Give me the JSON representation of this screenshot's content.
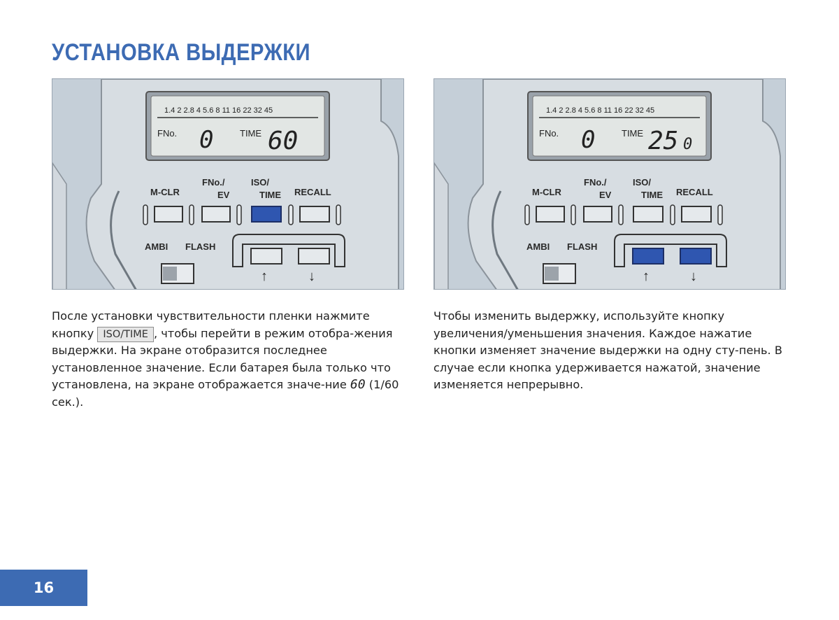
{
  "page": {
    "title": "УСТАНОВКА ВЫДЕРЖКИ",
    "number": "16",
    "accent_color": "#3d6bb3",
    "highlight_button_color": "#2f56b0"
  },
  "figures": [
    {
      "scale": "1.4  2  2.8  4  5.6  8  11  16  22  32  45",
      "fno_label": "FNo.",
      "fno_value": "0",
      "time_label": "TIME",
      "time_value": "60",
      "buttons": {
        "mclr": "M-CLR",
        "fno_ev_top": "FNo./",
        "fno_ev_bottom": "EV",
        "iso_top": "ISO/",
        "iso_bottom": "TIME",
        "recall": "RECALL"
      },
      "switch": {
        "ambi": "AMBI",
        "flash": "FLASH"
      },
      "arrows": {
        "up": "↑",
        "down": "↓"
      },
      "highlighted": [
        "iso-time"
      ]
    },
    {
      "scale": "1.4  2  2.8  4  5.6  8  11  16  22  32  45",
      "fno_label": "FNo.",
      "fno_value": "0",
      "time_label": "TIME",
      "time_value": "25",
      "time_suffix": "0",
      "buttons": {
        "mclr": "M-CLR",
        "fno_ev_top": "FNo./",
        "fno_ev_bottom": "EV",
        "iso_top": "ISO/",
        "iso_bottom": "TIME",
        "recall": "RECALL"
      },
      "switch": {
        "ambi": "AMBI",
        "flash": "FLASH"
      },
      "arrows": {
        "up": "↑",
        "down": "↓"
      },
      "highlighted": [
        "up",
        "down"
      ]
    }
  ],
  "left_text": {
    "part1": "После установки чувствительности пленки нажмите кнопку ",
    "key": "ISO/TIME",
    "part2": ", чтобы перейти в режим отобра-жения выдержки. На экране отобразится последнее установленное значение. Если батарея была только что установлена, на экране отображается значе-ние ",
    "display_value": "60",
    "part3": " (1/60 сек.)."
  },
  "right_text": {
    "body": "Чтобы изменить выдержку, используйте кнопку увеличения/уменьшения значения. Каждое нажатие кнопки изменяет значение выдержки на одну сту-пень. В случае если кнопка удерживается нажатой, значение изменяется непрерывно."
  }
}
